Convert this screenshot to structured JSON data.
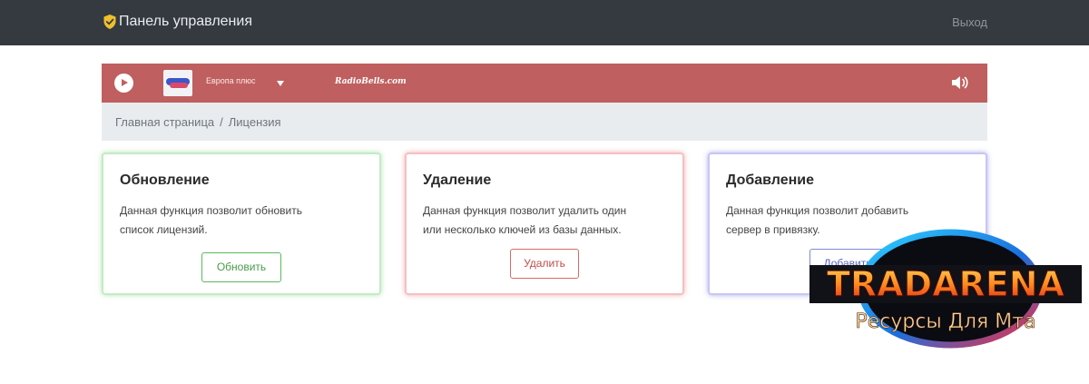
{
  "navbar": {
    "brand_icon": "shield-check-icon",
    "brand_title": "Панель управления",
    "logout_label": "Выход",
    "colors": {
      "background": "#343a40",
      "brand_icon": "#f0c02b"
    }
  },
  "player": {
    "play_icon": "play-icon",
    "station_logo": "station-logo",
    "station_name": "Европа плюс",
    "dropdown_icon": "caret-down-icon",
    "site_label": "RadioBells.com",
    "volume_icon": "volume-icon",
    "colors": {
      "background": "#bf5f5f"
    }
  },
  "breadcrumb": {
    "items": [
      "Главная страница",
      "Лицензия"
    ],
    "separator": "/"
  },
  "cards": [
    {
      "title": "Обновление",
      "text_line1": "Данная функция позволит обновить",
      "text_line2": "список лицензий.",
      "button_label": "Обновить",
      "accent": "#5cb85c"
    },
    {
      "title": "Удаление",
      "text_line1": "Данная функция позволит удалить один",
      "text_line2": "или несколько ключей из базы данных.",
      "button_label": "Удалить",
      "accent": "#d9534f"
    },
    {
      "title": "Добавление",
      "text_line1": "Данная функция позволит добавить",
      "text_line2": "сервер в привязку.",
      "button_label": "Добавить",
      "accent": "#5b67c4"
    }
  ],
  "watermark": {
    "line1": "TRADARENA",
    "line2": "Ресурсы Для Мта"
  }
}
